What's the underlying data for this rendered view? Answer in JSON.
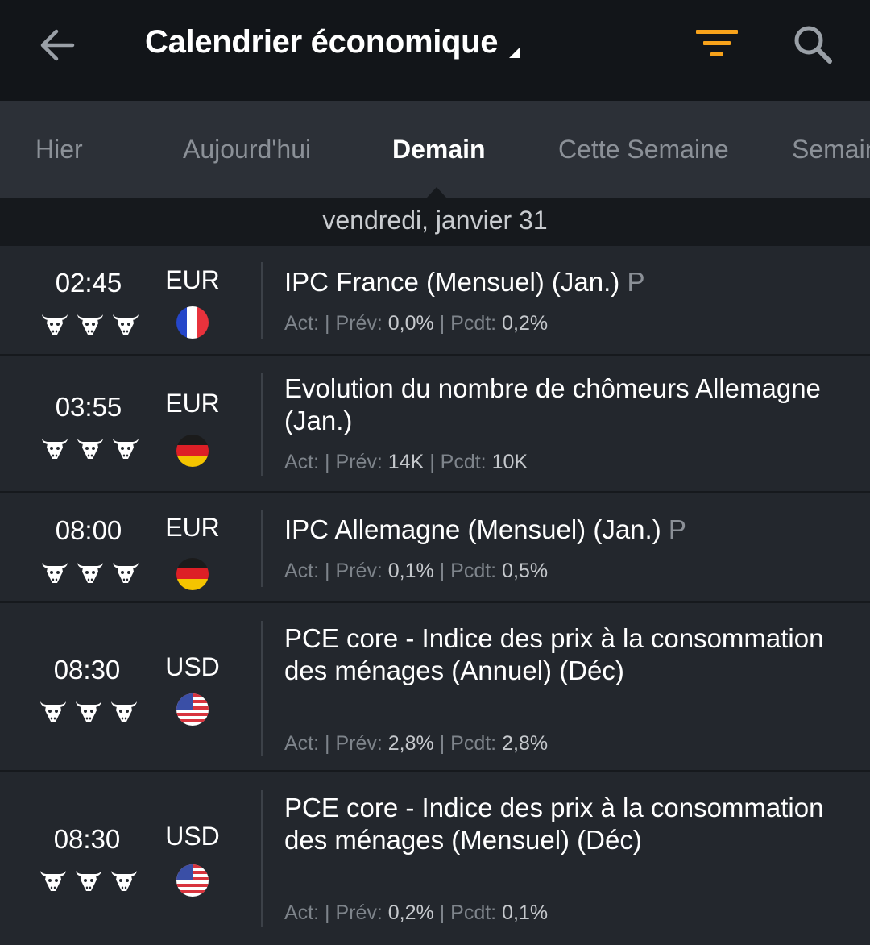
{
  "header": {
    "title": "Calendrier économique",
    "accent_color": "#f7a21b",
    "icons": [
      "arrow-left-icon",
      "caret-down-icon",
      "filter-icon",
      "search-icon"
    ]
  },
  "tabs": [
    {
      "label": "Hier",
      "active": false
    },
    {
      "label": "Aujourd'hui",
      "active": false
    },
    {
      "label": "Demain",
      "active": true
    },
    {
      "label": "Cette Semaine",
      "active": false
    },
    {
      "label": "Semaine Prochaine",
      "active": false
    }
  ],
  "date_header": "vendredi, janvier 31",
  "stat_labels": {
    "act": "Act:",
    "prev": "| Prév:",
    "pcdt": "| Pcdt:"
  },
  "events": [
    {
      "time": "02:45",
      "importance": 3,
      "currency": "EUR",
      "country": "France",
      "title": "IPC France (Mensuel) (Jan.)",
      "prelim": "P",
      "actual": "",
      "forecast": "0,0%",
      "previous": "0,2%"
    },
    {
      "time": "03:55",
      "importance": 3,
      "currency": "EUR",
      "country": "Allemagne",
      "title": "Evolution du nombre de chômeurs Allemagne (Jan.)",
      "prelim": "",
      "actual": "",
      "forecast": "14K",
      "previous": "10K"
    },
    {
      "time": "08:00",
      "importance": 3,
      "currency": "EUR",
      "country": "Allemagne",
      "title": "IPC Allemagne (Mensuel) (Jan.)",
      "prelim": "P",
      "actual": "",
      "forecast": "0,1%",
      "previous": "0,5%"
    },
    {
      "time": "08:30",
      "importance": 3,
      "currency": "USD",
      "country": "États-Unis",
      "title": "PCE core - Indice des prix à la consommation des ménages (Annuel) (Déc)",
      "prelim": "",
      "actual": "",
      "forecast": "2,8%",
      "previous": "2,8%"
    },
    {
      "time": "08:30",
      "importance": 3,
      "currency": "USD",
      "country": "États-Unis",
      "title": "PCE core - Indice des prix à la consommation des ménages (Mensuel) (Déc)",
      "prelim": "",
      "actual": "",
      "forecast": "0,2%",
      "previous": "0,1%"
    }
  ]
}
